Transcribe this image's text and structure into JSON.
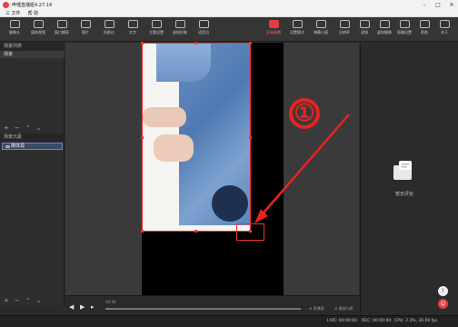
{
  "window": {
    "title": "哔哩直播姬4.27.14",
    "controls": [
      "–",
      "□",
      "✕"
    ]
  },
  "menu": [
    "三 文件",
    "帮 助"
  ],
  "toolbar": [
    {
      "label": "摄像头",
      "icon": "camera-icon"
    },
    {
      "label": "媒体视频",
      "icon": "media-icon"
    },
    {
      "label": "窗口捕获",
      "icon": "window-icon"
    },
    {
      "label": "图片",
      "icon": "image-icon"
    },
    {
      "label": "投影仪",
      "icon": "projector-icon"
    },
    {
      "label": "文字",
      "icon": "text-icon"
    },
    {
      "label": "主题设置",
      "icon": "theme-icon"
    },
    {
      "label": "虚拟形象",
      "icon": "avatar-icon"
    },
    {
      "label": "语音功",
      "icon": "voice-icon"
    },
    {
      "label": "开始直播",
      "icon": "live-icon",
      "active": true
    },
    {
      "label": "设置模式",
      "icon": "mode-icon"
    },
    {
      "label": "弹幕小窗",
      "icon": "danmaku-icon"
    },
    {
      "label": "分辨率",
      "icon": "resolution-icon"
    },
    {
      "label": "滤镜",
      "icon": "filter-icon"
    },
    {
      "label": "虚拟摄像",
      "icon": "virtualcam-icon"
    },
    {
      "label": "直播设置",
      "icon": "settings-icon"
    },
    {
      "label": "帮助",
      "icon": "help-icon"
    },
    {
      "label": "关于",
      "icon": "about-icon"
    }
  ],
  "left": {
    "scenes_header": "场景列表",
    "scene": "场景",
    "sources_header": "场景元素",
    "source": "媒体源",
    "tool_icons": [
      "+",
      "−",
      "⌃",
      "⌄"
    ]
  },
  "canvas": {
    "callout": "①"
  },
  "playback": {
    "time": "00:00",
    "left_text": "⊕ 直播源",
    "right_text": "⊕ 播放列表"
  },
  "right": {
    "chat_label": "暂无评论"
  },
  "status": {
    "live": "LIVE: 00:00:00",
    "rec": "REC: 00:00:00",
    "cpu": "CPU: 2.3%, 30.00 fps"
  },
  "colors": {
    "accent": "#e63b43",
    "selection": "#e33333",
    "callout": "#e8231f"
  }
}
